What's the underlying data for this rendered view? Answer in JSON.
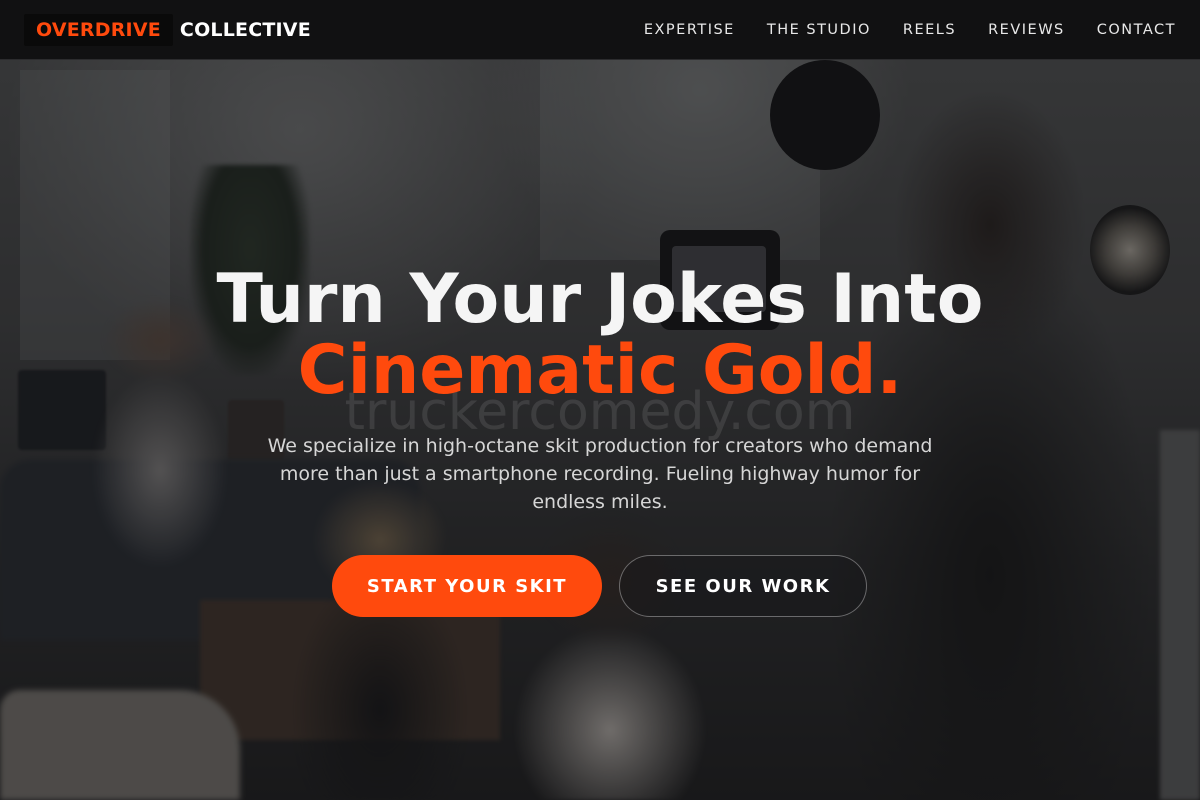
{
  "brand": {
    "highlight": "OVERDRIVE",
    "rest": "COLLECTIVE",
    "highlight_color": "#ff4a0d"
  },
  "nav": {
    "items": [
      {
        "label": "EXPERTISE"
      },
      {
        "label": "THE STUDIO"
      },
      {
        "label": "REELS"
      },
      {
        "label": "REVIEWS"
      },
      {
        "label": "CONTACT"
      }
    ]
  },
  "hero": {
    "headline_line1": "Turn Your Jokes Into",
    "headline_line2": "Cinematic Gold.",
    "watermark": "truckercomedy.com",
    "subcopy": "We specialize in high-octane skit production for creators who demand more than just a smartphone recording. Fueling highway humor for endless miles.",
    "primary_cta": "START YOUR SKIT",
    "secondary_cta": "SEE OUR WORK",
    "accent_color": "#ff4a0d"
  }
}
